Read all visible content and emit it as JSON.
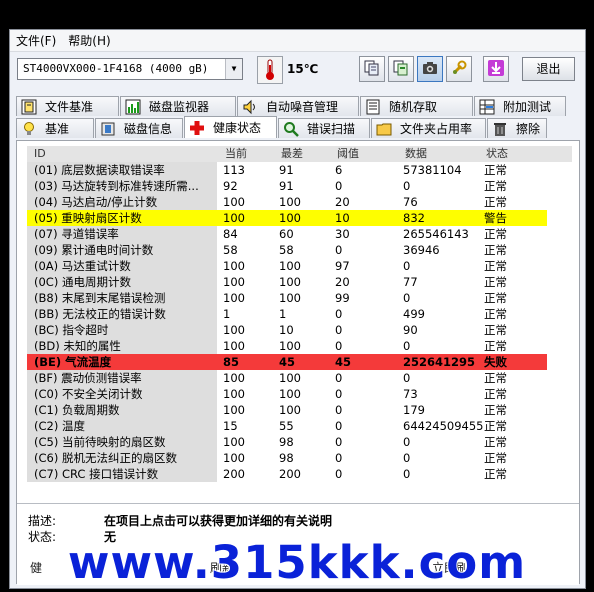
{
  "menu": {
    "file": "文件(F)",
    "help": "帮助(H)"
  },
  "toolbar": {
    "drive": "ST4000VX000-1F4168 (4000 gB)",
    "temperature": "15℃",
    "exit_label": "退出",
    "buttons": [
      "copy-icon",
      "copy-green-icon",
      "camera-icon",
      "wrench-icon",
      "download-icon"
    ]
  },
  "tabs_top": [
    {
      "label": "文件基准",
      "icon": "info-icon"
    },
    {
      "label": "磁盘监视器",
      "icon": "chart-icon"
    },
    {
      "label": "自动噪音管理",
      "icon": "speaker-icon"
    },
    {
      "label": "随机存取",
      "icon": "list-icon"
    },
    {
      "label": "附加测试",
      "icon": "grid-icon"
    }
  ],
  "tabs_bottom": [
    {
      "label": "基准",
      "icon": "bulb-icon"
    },
    {
      "label": "磁盘信息",
      "icon": "disk-icon"
    },
    {
      "label": "健康状态",
      "icon": "health-cross-icon",
      "active": true
    },
    {
      "label": "错误扫描",
      "icon": "magnifier-icon"
    },
    {
      "label": "文件夹占用率",
      "icon": "folder-icon"
    },
    {
      "label": "擦除",
      "icon": "trash-icon"
    }
  ],
  "table": {
    "headers": {
      "id": "ID",
      "current": "当前",
      "worst": "最差",
      "threshold": "阈值",
      "data": "数据",
      "status": "状态"
    },
    "rows": [
      {
        "id": "(01) 底层数据读取错误率",
        "current": "113",
        "worst": "91",
        "threshold": "6",
        "data": "57381104",
        "status": "正常"
      },
      {
        "id": "(03) 马达旋转到标准转速所需...",
        "current": "92",
        "worst": "91",
        "threshold": "0",
        "data": "0",
        "status": "正常"
      },
      {
        "id": "(04) 马达启动/停止计数",
        "current": "100",
        "worst": "100",
        "threshold": "20",
        "data": "76",
        "status": "正常"
      },
      {
        "id": "(05) 重映射扇区计数",
        "current": "100",
        "worst": "100",
        "threshold": "10",
        "data": "832",
        "status": "警告",
        "level": "warn"
      },
      {
        "id": "(07) 寻道错误率",
        "current": "84",
        "worst": "60",
        "threshold": "30",
        "data": "265546143",
        "status": "正常"
      },
      {
        "id": "(09) 累计通电时间计数",
        "current": "58",
        "worst": "58",
        "threshold": "0",
        "data": "36946",
        "status": "正常"
      },
      {
        "id": "(0A) 马达重试计数",
        "current": "100",
        "worst": "100",
        "threshold": "97",
        "data": "0",
        "status": "正常"
      },
      {
        "id": "(0C) 通电周期计数",
        "current": "100",
        "worst": "100",
        "threshold": "20",
        "data": "77",
        "status": "正常"
      },
      {
        "id": "(B8) 末尾到末尾错误检测",
        "current": "100",
        "worst": "100",
        "threshold": "99",
        "data": "0",
        "status": "正常"
      },
      {
        "id": "(BB) 无法校正的错误计数",
        "current": "1",
        "worst": "1",
        "threshold": "0",
        "data": "499",
        "status": "正常"
      },
      {
        "id": "(BC) 指令超时",
        "current": "100",
        "worst": "10",
        "threshold": "0",
        "data": "90",
        "status": "正常"
      },
      {
        "id": "(BD) 未知的属性",
        "current": "100",
        "worst": "100",
        "threshold": "0",
        "data": "0",
        "status": "正常"
      },
      {
        "id": "(BE) 气流温度",
        "current": "85",
        "worst": "45",
        "threshold": "45",
        "data": "252641295",
        "status": "失败",
        "level": "fail"
      },
      {
        "id": "(BF) 震动侦测错误率",
        "current": "100",
        "worst": "100",
        "threshold": "0",
        "data": "0",
        "status": "正常"
      },
      {
        "id": "(C0) 不安全关闭计数",
        "current": "100",
        "worst": "100",
        "threshold": "0",
        "data": "73",
        "status": "正常"
      },
      {
        "id": "(C1) 负载周期数",
        "current": "100",
        "worst": "100",
        "threshold": "0",
        "data": "179",
        "status": "正常"
      },
      {
        "id": "(C2) 温度",
        "current": "15",
        "worst": "55",
        "threshold": "0",
        "data": "64424509455",
        "status": "正常"
      },
      {
        "id": "(C5) 当前待映射的扇区数",
        "current": "100",
        "worst": "98",
        "threshold": "0",
        "data": "0",
        "status": "正常"
      },
      {
        "id": "(C6) 脱机无法纠正的扇区数",
        "current": "100",
        "worst": "98",
        "threshold": "0",
        "data": "0",
        "status": "正常"
      },
      {
        "id": "(C7) CRC 接口错误计数",
        "current": "200",
        "worst": "200",
        "threshold": "0",
        "data": "0",
        "status": "正常"
      }
    ]
  },
  "info": {
    "desc_label": "描述:",
    "desc_value": "在项目上点击可以获得更加详细的有关说明",
    "status_label": "状态:",
    "status_value": "无"
  },
  "bottom": {
    "left": "健",
    "mid": "刷新",
    "right": "立即刷"
  },
  "watermark": "www.315kkk.com",
  "colors": {
    "warn": "#fefe00",
    "fail": "#f43a3a",
    "watermark": "#0a22d8"
  }
}
